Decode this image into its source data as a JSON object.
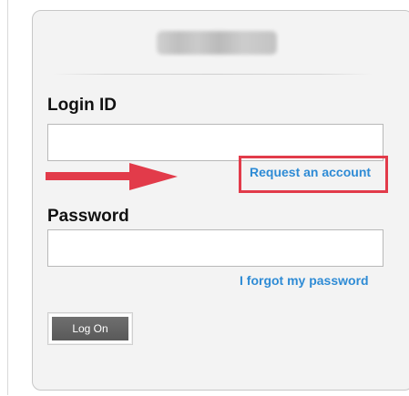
{
  "login": {
    "login_id_label": "Login ID",
    "password_label": "Password",
    "login_id_value": "",
    "password_value": "",
    "request_account_label": "Request an account",
    "forgot_password_label": "I forgot my password",
    "logon_button_label": "Log On"
  },
  "colors": {
    "panel_background": "#f3f3f3",
    "link_blue": "#2e8bd5",
    "annotation_red": "#e23b4a",
    "button_gray": "#595959"
  },
  "icons": {
    "annotation_arrow": "right-arrow-icon"
  }
}
